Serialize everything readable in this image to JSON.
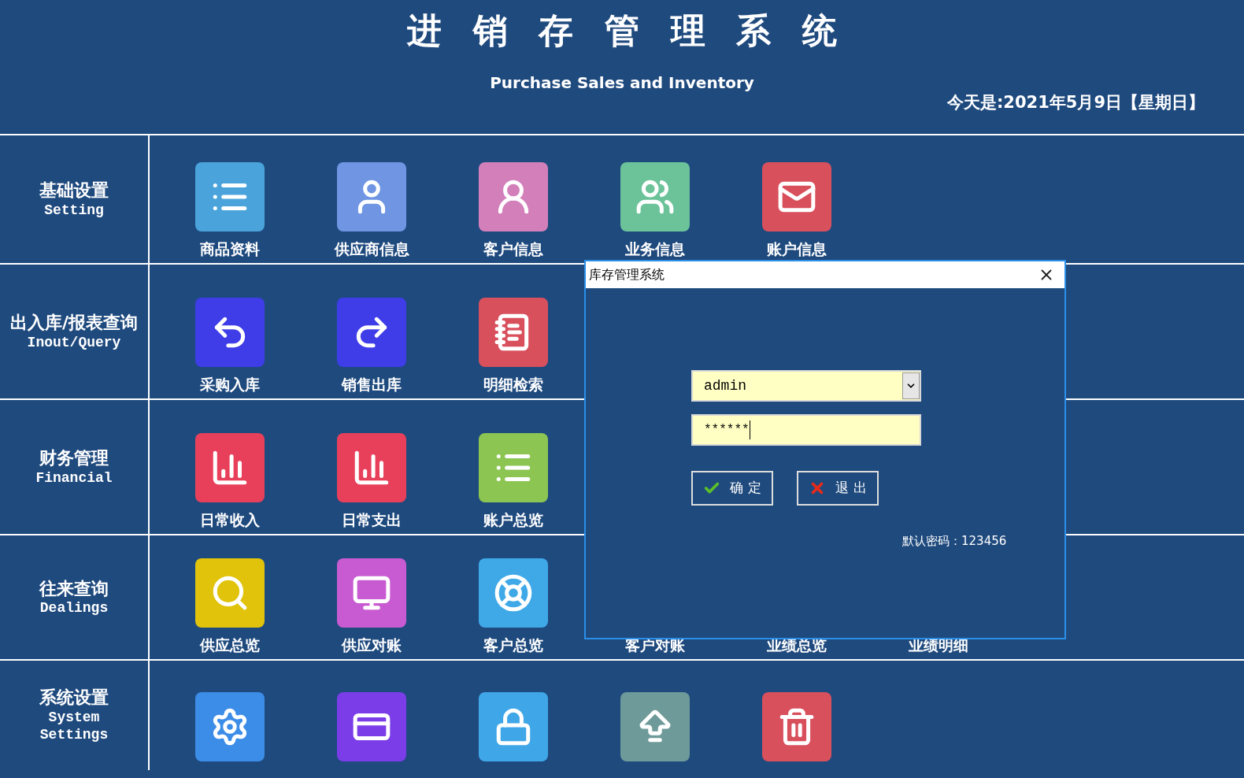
{
  "header": {
    "title": "进销存管理系统",
    "subtitle": "Purchase Sales and Inventory",
    "date": "今天是:2021年5月9日【星期日】"
  },
  "sections": [
    {
      "title": "基础设置",
      "title_en": [
        "Setting"
      ],
      "items": [
        {
          "kind": "list",
          "color": "#4aa3db",
          "label": "商品资料"
        },
        {
          "kind": "user",
          "color": "#6f95e3",
          "label": "供应商信息"
        },
        {
          "kind": "userf",
          "color": "#d27fba",
          "label": "客户信息"
        },
        {
          "kind": "users",
          "color": "#6cc39a",
          "label": "业务信息"
        },
        {
          "kind": "mail",
          "color": "#d9505d",
          "label": "账户信息"
        }
      ]
    },
    {
      "title": "出入库/报表查询",
      "title_en": [
        "Inout/Query"
      ],
      "items": [
        {
          "kind": "undo",
          "color": "#3f3de8",
          "label": "采购入库"
        },
        {
          "kind": "redo",
          "color": "#3f3de8",
          "label": "销售出库"
        },
        {
          "kind": "notepad",
          "color": "#d9505d",
          "label": "明细检索"
        }
      ]
    },
    {
      "title": "财务管理",
      "title_en": [
        "Financial"
      ],
      "items": [
        {
          "kind": "chart",
          "color": "#e8405a",
          "label": "日常收入"
        },
        {
          "kind": "chart",
          "color": "#e8405a",
          "label": "日常支出"
        },
        {
          "kind": "list",
          "color": "#8cc552",
          "label": "账户总览"
        }
      ]
    },
    {
      "title": "往来查询",
      "title_en": [
        "Dealings"
      ],
      "items": [
        {
          "kind": "search",
          "color": "#e0c30a",
          "label": "供应总览"
        },
        {
          "kind": "monitor",
          "color": "#c85bd1",
          "label": "供应对账"
        },
        {
          "kind": "lifebuoy",
          "color": "#3fa9e8",
          "label": "客户总览"
        },
        {
          "kind": "hidden",
          "label": "客户对账"
        },
        {
          "kind": "hidden",
          "label": "业绩总览"
        },
        {
          "kind": "hidden",
          "label": "业绩明细"
        }
      ]
    },
    {
      "title": "系统设置",
      "title_en": [
        "System",
        "Settings"
      ],
      "items": [
        {
          "kind": "gear",
          "color": "#3c8de8"
        },
        {
          "kind": "card",
          "color": "#7a3de8"
        },
        {
          "kind": "lock",
          "color": "#3fa6e8"
        },
        {
          "kind": "upload",
          "color": "#6f9a9a"
        },
        {
          "kind": "trash",
          "color": "#d9505d"
        }
      ]
    }
  ],
  "dialog": {
    "title": "库存管理系统",
    "username": "admin",
    "password": "******",
    "buttons": [
      {
        "kind": "ok",
        "label": "确 定"
      },
      {
        "kind": "cancel",
        "label": "退 出"
      }
    ],
    "hint": "默认密码：123456"
  }
}
